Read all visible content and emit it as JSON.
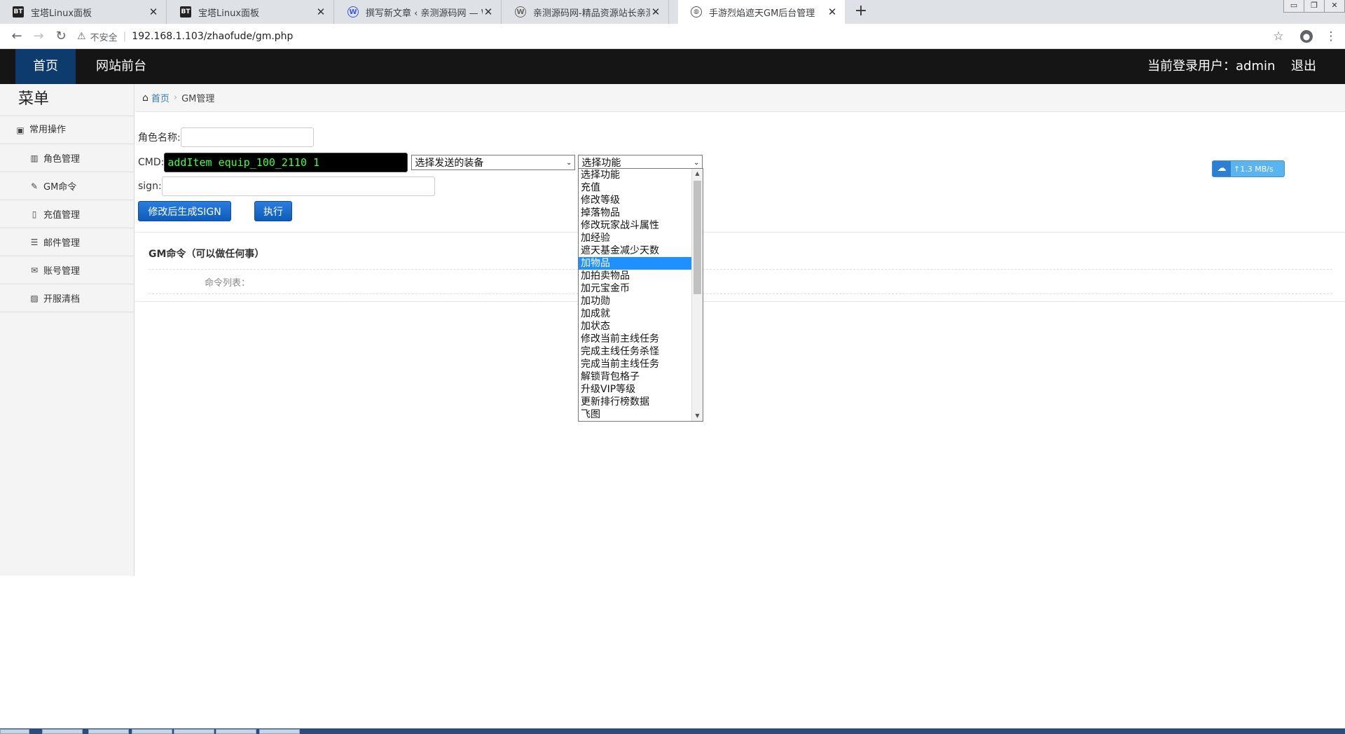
{
  "browser": {
    "tabs": [
      {
        "title": "宝塔Linux面板",
        "favicon": "BT",
        "active": false
      },
      {
        "title": "宝塔Linux面板",
        "favicon": "BT",
        "active": false
      },
      {
        "title": "撰写新文章 ‹ 亲测源码网 — Wor",
        "favicon": "W",
        "active": false
      },
      {
        "title": "亲测源码网-精品资源站长亲测",
        "favicon": "W",
        "active": false
      },
      {
        "title": "手游烈焰遮天GM后台管理",
        "favicon": "globe",
        "active": true
      }
    ],
    "close_glyph": "✕",
    "new_tab_glyph": "+",
    "address": {
      "insecure_label": "不安全",
      "url": "192.168.1.103/zhaofude/gm.php"
    }
  },
  "header": {
    "home_label": "首页",
    "front_label": "网站前台",
    "user_label": "当前登录用户：admin",
    "logout_label": "退出"
  },
  "sidebar": {
    "title": "菜单",
    "group_label": "常用操作",
    "items": [
      {
        "label": "角色管理",
        "icon": "roles-icon"
      },
      {
        "label": "GM命令",
        "icon": "wrench-icon"
      },
      {
        "label": "充值管理",
        "icon": "file-icon"
      },
      {
        "label": "邮件管理",
        "icon": "list-icon"
      },
      {
        "label": "账号管理",
        "icon": "mail-icon"
      },
      {
        "label": "开服清档",
        "icon": "image-icon"
      }
    ]
  },
  "breadcrumb": {
    "home": "首页",
    "current": "GM管理"
  },
  "form": {
    "role_name_label": "角色名称:",
    "role_name_value": "",
    "cmd_label": "CMD:",
    "cmd_value": "addItem equip_100_2110 1",
    "equip_select": "选择发送的装备",
    "function_select": "选择功能",
    "sign_label": "sign:",
    "sign_value": "",
    "gen_sign_button": "修改后生成SIGN",
    "execute_button": "执行"
  },
  "dropdown": {
    "options": [
      "选择功能",
      "充值",
      "修改等级",
      "掉落物品",
      "修改玩家战斗属性",
      "加经验",
      "遮天基金减少天数",
      "加物品",
      "加拍卖物品",
      "加元宝金币",
      "加功勋",
      "加成就",
      "加状态",
      "修改当前主线任务",
      "完成主线任务杀怪",
      "完成当前主线任务",
      "解锁背包格子",
      "升级VIP等级",
      "更新排行榜数据",
      "飞图"
    ],
    "highlighted_index": 7
  },
  "section": {
    "title": "GM命令（可以做任何事）",
    "command_list_label": "命令列表："
  },
  "speed_widget": {
    "label": "↑1.3 MB/s"
  }
}
